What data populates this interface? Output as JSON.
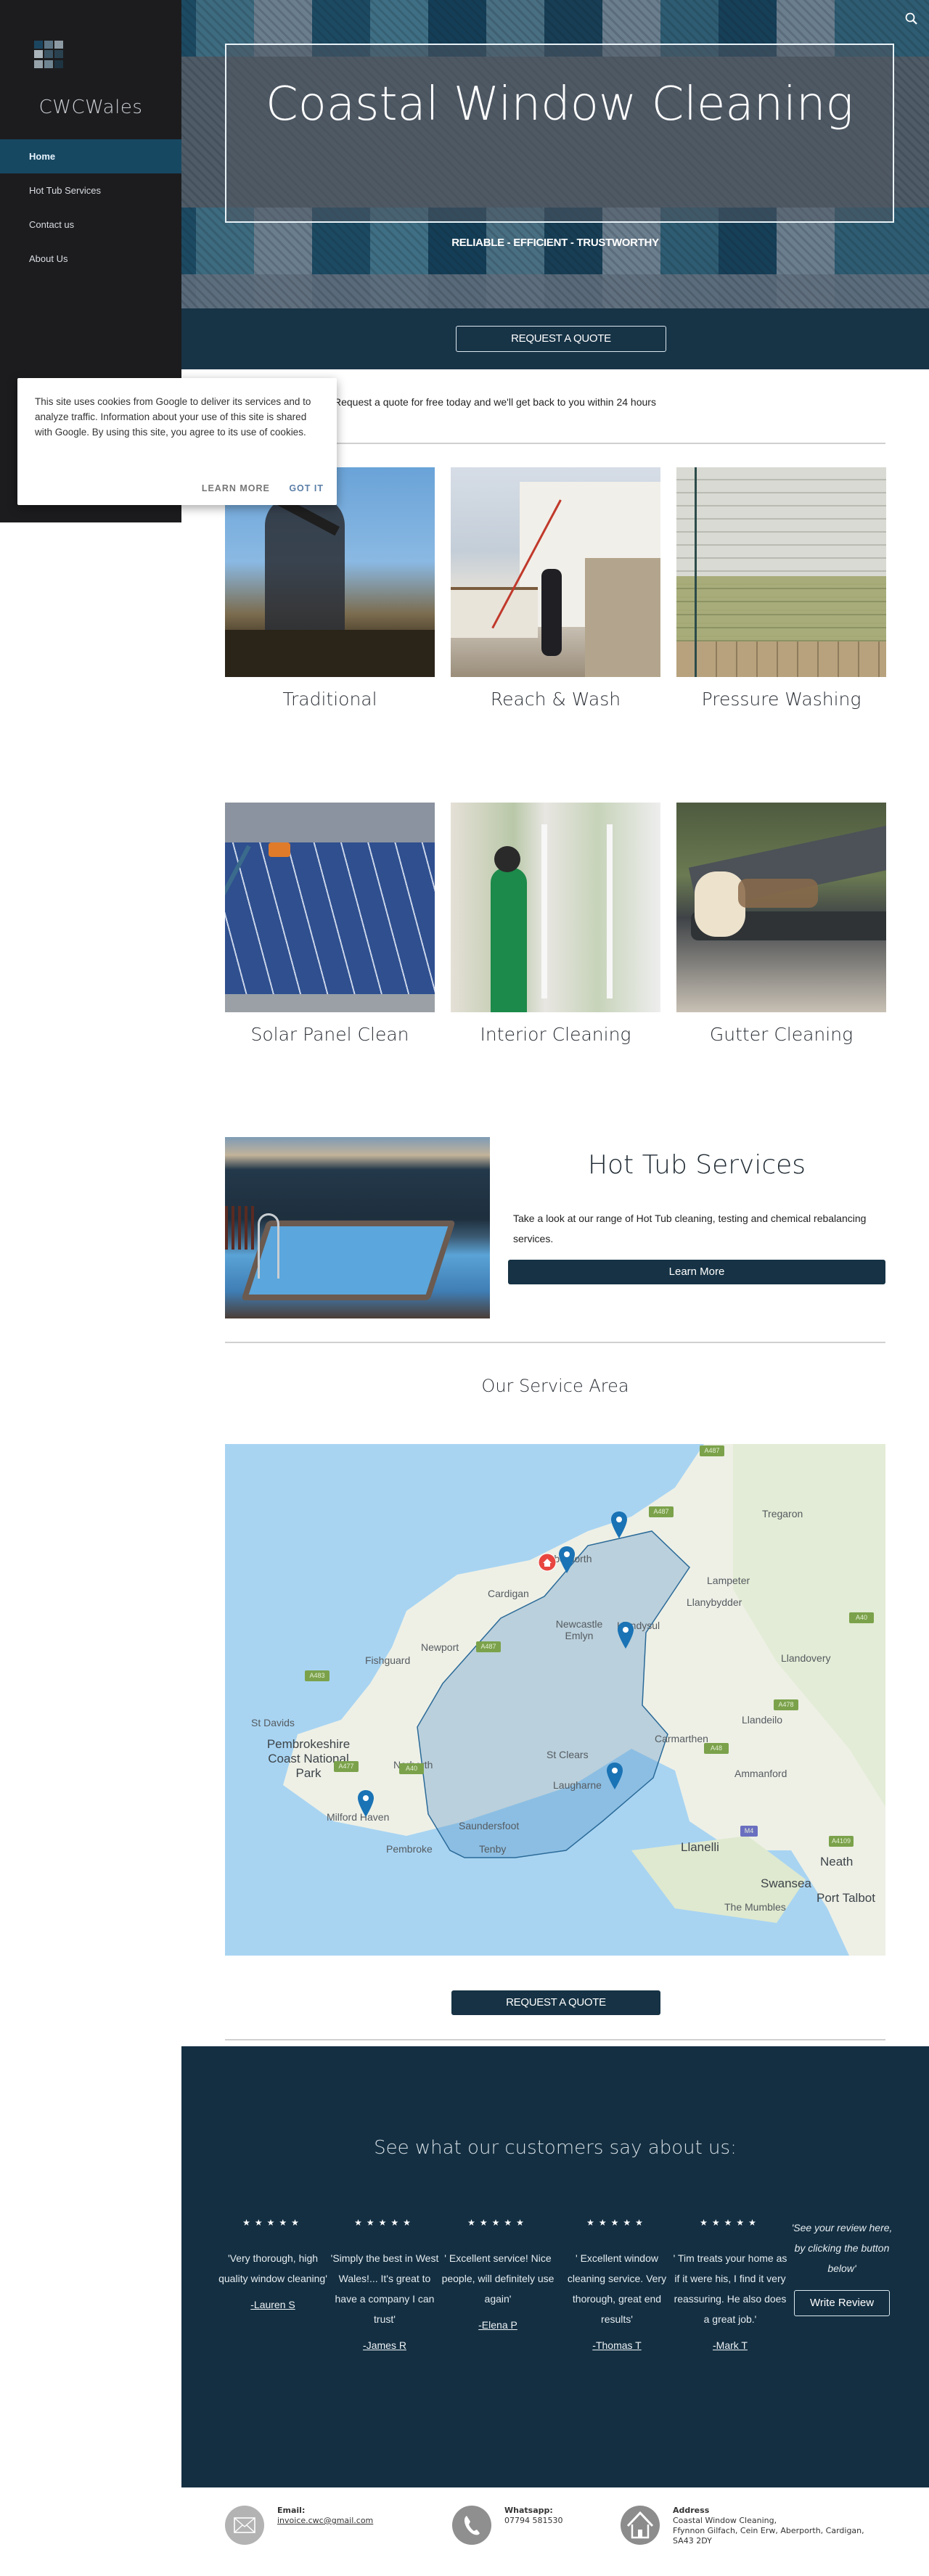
{
  "site": {
    "name": "CWCWales",
    "search_icon": "search-icon"
  },
  "sidebar": {
    "items": [
      {
        "label": "Home",
        "active": true
      },
      {
        "label": "Hot Tub Services",
        "active": false
      },
      {
        "label": "Contact us",
        "active": false
      },
      {
        "label": "About Us",
        "active": false
      }
    ]
  },
  "hero": {
    "title": "Coastal Window Cleaning",
    "tagline": "RELIABLE - EFFICIENT - TRUSTWORTHY",
    "cta_label": "REQUEST A QUOTE"
  },
  "intro": {
    "text": "Request a quote for free today and we'll get back to you within 24 hours"
  },
  "services": [
    {
      "label": "Traditional"
    },
    {
      "label": "Reach & Wash"
    },
    {
      "label": "Pressure Washing"
    },
    {
      "label": "Solar Panel Clean"
    },
    {
      "label": "Interior Cleaning"
    },
    {
      "label": "Gutter Cleaning"
    }
  ],
  "hottub": {
    "title": "Hot Tub Services",
    "description": "Take a look at our range of Hot Tub cleaning, testing and chemical rebalancing services.",
    "button_label": "Learn More"
  },
  "service_area": {
    "title": "Our Service Area",
    "map_labels": [
      "Tregaron",
      "Aberporth",
      "Cardigan",
      "Lampeter",
      "Llanybydder",
      "Newcastle Emlyn",
      "Llandysul",
      "Newport",
      "Fishguard",
      "Llandovery",
      "St Davids",
      "Pembrokeshire Coast National Park",
      "Narberth",
      "St Clears",
      "Carmarthen",
      "Llandeilo",
      "Ammanford",
      "Laugharne",
      "Milford Haven",
      "Saundersfoot",
      "Pembroke",
      "Tenby",
      "Llanelli",
      "Neath",
      "Swansea",
      "Port Talbot",
      "The Mumbles"
    ],
    "road_badges": [
      "A487",
      "A487",
      "A487",
      "A40",
      "A483",
      "A478",
      "A477",
      "A40",
      "A48",
      "M4",
      "A4109"
    ],
    "cta_label": "REQUEST A QUOTE"
  },
  "reviews": {
    "title": "See what our customers say about us:",
    "stars": "★★★★★",
    "items": [
      {
        "rating": 5,
        "quote": "'Very thorough, high quality window cleaning'",
        "author": "-Lauren S"
      },
      {
        "rating": 5,
        "quote": "'Simply the best in West Wales!... It's great to have a company I can trust'",
        "author": "-James R"
      },
      {
        "rating": 5,
        "quote": "' Excellent service! Nice people, will definitely use again'",
        "author": "-Elena P"
      },
      {
        "rating": 5,
        "quote": "' Excellent window cleaning service. Very thorough, great end results'",
        "author": "-Thomas T"
      },
      {
        "rating": 5,
        "quote": "' Tim treats your home as if it were his, I find it very reassuring. He also does a great job.'",
        "author": "-Mark T"
      }
    ],
    "invite": "'See your review here, by clicking the button below'",
    "write_review_label": "Write Review"
  },
  "footer": {
    "email_heading": "Email:",
    "email": "invoice.cwc@gmail.com",
    "whatsapp_heading": "Whatsapp:",
    "whatsapp": "07794 581530",
    "address_heading": "Address",
    "address_line1": "Coastal Window Cleaning,",
    "address_line2": "Ffynnon Gilfach, Cein Erw, Aberporth, Cardigan,",
    "address_line3": "SA43 2DY"
  },
  "cookie": {
    "message": "This site uses cookies from Google to deliver its services and to analyze traffic. Information about your use of this site is shared with Google. By using this site, you agree to its use of cookies.",
    "learn_more": "LEARN MORE",
    "got_it": "GOT IT"
  }
}
